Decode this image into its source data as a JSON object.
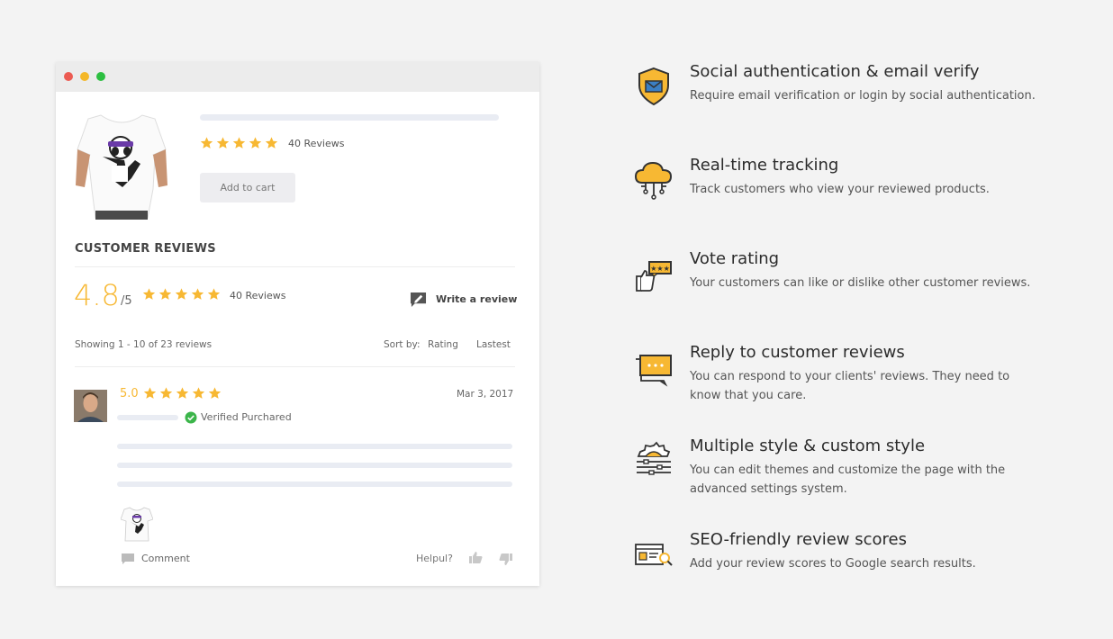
{
  "product": {
    "reviews_count": "40 Reviews",
    "add_to_cart_label": "Add to cart",
    "rating_stars": 5
  },
  "reviews": {
    "section_title": "CUSTOMER REVIEWS",
    "average_score": "4.8",
    "score_denominator": "/5",
    "reviews_count": "40 Reviews",
    "write_review_label": "Write a review",
    "showing_text": "Showing 1 - 10 of 23 reviews",
    "sort_by_label": "Sort by:",
    "sort_options": [
      "Rating",
      "Lastest"
    ],
    "item": {
      "score": "5.0",
      "date": "Mar 3, 2017",
      "verified_label": "Verified Purchared",
      "comment_label": "Comment",
      "helpful_label": "Helpul?"
    }
  },
  "features": [
    {
      "icon": "shield-mail-icon",
      "title": "Social authentication & email verify",
      "description": "Require email verification or login by social authentication."
    },
    {
      "icon": "cloud-network-icon",
      "title": "Real-time tracking",
      "description": "Track customers who view your reviewed products."
    },
    {
      "icon": "thumb-rating-icon",
      "title": "Vote rating",
      "description": "Your customers can like or dislike other customer reviews."
    },
    {
      "icon": "chat-reply-icon",
      "title": "Reply to customer reviews",
      "description": "You can respond to your clients' reviews. They need to know that you care."
    },
    {
      "icon": "gear-style-icon",
      "title": "Multiple style & custom style",
      "description": "You can edit themes and customize the page with the advanced settings system."
    },
    {
      "icon": "seo-search-icon",
      "title": "SEO-friendly review scores",
      "description": "Add your review scores to Google search results."
    }
  ],
  "colors": {
    "star": "#f7b833",
    "accent": "#f7b833",
    "verified": "#3bb54a",
    "background": "#f3f3f3"
  }
}
